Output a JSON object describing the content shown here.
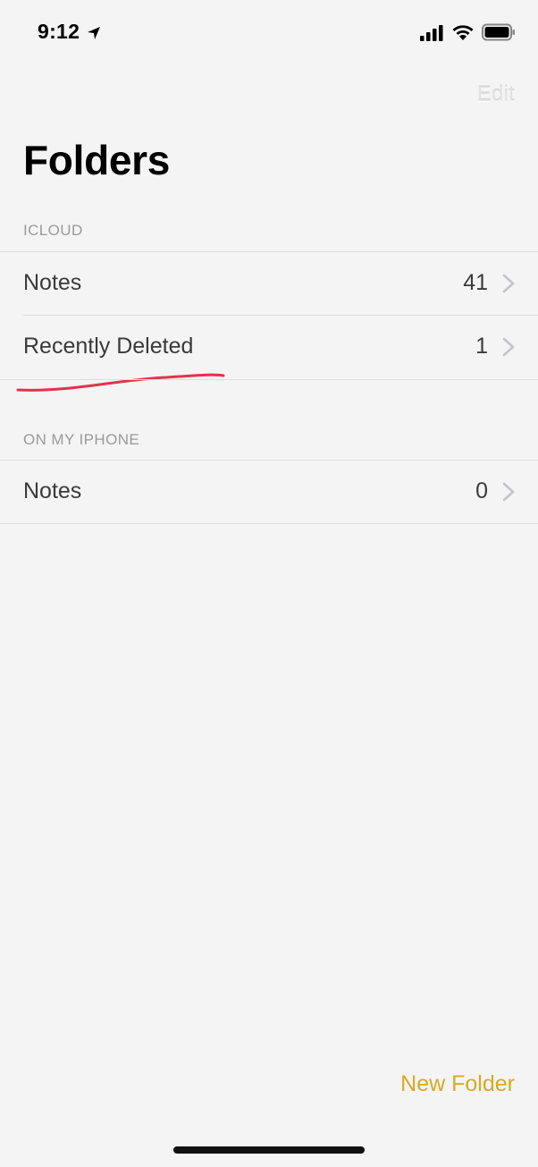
{
  "status_bar": {
    "time": "9:12",
    "icons": [
      "location-arrow-icon",
      "cellular-signal-icon",
      "wifi-icon",
      "battery-icon"
    ]
  },
  "nav": {
    "edit_label": "Edit",
    "title": "Folders"
  },
  "sections": [
    {
      "header": "ICLOUD",
      "items": [
        {
          "label": "Notes",
          "count": "41"
        },
        {
          "label": "Recently Deleted",
          "count": "1"
        }
      ]
    },
    {
      "header": "ON MY IPHONE",
      "items": [
        {
          "label": "Notes",
          "count": "0"
        }
      ]
    }
  ],
  "toolbar": {
    "new_folder_label": "New Folder"
  },
  "colors": {
    "accent": "#d8a924",
    "annotation": "#e0334d",
    "background": "#f4f4f4"
  }
}
